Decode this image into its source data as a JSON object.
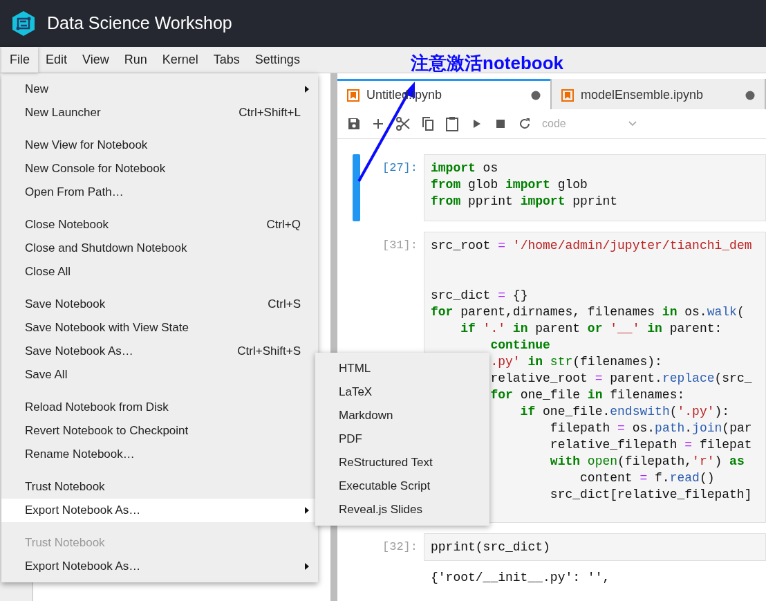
{
  "app": {
    "title": "Data Science Workshop"
  },
  "menu_bar": [
    {
      "label": "File",
      "selected": true
    },
    {
      "label": "Edit",
      "selected": false
    },
    {
      "label": "View",
      "selected": false
    },
    {
      "label": "Run",
      "selected": false
    },
    {
      "label": "Kernel",
      "selected": false
    },
    {
      "label": "Tabs",
      "selected": false
    },
    {
      "label": "Settings",
      "selected": false
    }
  ],
  "file_menu": [
    [
      {
        "label": "New",
        "submenu": true,
        "disabled": false,
        "selected": false
      },
      {
        "label": "New Launcher",
        "shortcut": "Ctrl+Shift+L",
        "submenu": false,
        "disabled": false,
        "selected": false
      }
    ],
    [
      {
        "label": "New View for Notebook",
        "submenu": false,
        "disabled": false,
        "selected": false
      },
      {
        "label": "New Console for Notebook",
        "submenu": false,
        "disabled": false,
        "selected": false
      },
      {
        "label": "Open From Path…",
        "submenu": false,
        "disabled": false,
        "selected": false
      }
    ],
    [
      {
        "label": "Close Notebook",
        "shortcut": "Ctrl+Q",
        "submenu": false,
        "disabled": false,
        "selected": false
      },
      {
        "label": "Close and Shutdown Notebook",
        "submenu": false,
        "disabled": false,
        "selected": false
      },
      {
        "label": "Close All",
        "submenu": false,
        "disabled": false,
        "selected": false
      }
    ],
    [
      {
        "label": "Save Notebook",
        "shortcut": "Ctrl+S",
        "submenu": false,
        "disabled": false,
        "selected": false
      },
      {
        "label": "Save Notebook with View State",
        "submenu": false,
        "disabled": false,
        "selected": false
      },
      {
        "label": "Save Notebook As…",
        "shortcut": "Ctrl+Shift+S",
        "submenu": false,
        "disabled": false,
        "selected": false
      },
      {
        "label": "Save All",
        "submenu": false,
        "disabled": false,
        "selected": false
      }
    ],
    [
      {
        "label": "Reload Notebook from Disk",
        "submenu": false,
        "disabled": false,
        "selected": false
      },
      {
        "label": "Revert Notebook to Checkpoint",
        "submenu": false,
        "disabled": false,
        "selected": false
      },
      {
        "label": "Rename Notebook…",
        "submenu": false,
        "disabled": false,
        "selected": false
      }
    ],
    [
      {
        "label": "Trust Notebook",
        "submenu": false,
        "disabled": false,
        "selected": false
      },
      {
        "label": "Export Notebook As…",
        "submenu": true,
        "disabled": false,
        "selected": true
      }
    ],
    [
      {
        "label": "Trust Notebook",
        "submenu": false,
        "disabled": true,
        "selected": false
      },
      {
        "label": "Export Notebook As…",
        "submenu": true,
        "disabled": false,
        "selected": false
      }
    ]
  ],
  "export_submenu": [
    "HTML",
    "LaTeX",
    "Markdown",
    "PDF",
    "ReStructured Text",
    "Executable Script",
    "Reveal.js Slides"
  ],
  "annotation": {
    "text": "注意激活notebook"
  },
  "tabs": [
    {
      "label": "Untitled.ipynb",
      "selected": true
    },
    {
      "label": "modelEnsemble.ipynb",
      "selected": false
    }
  ],
  "toolbar": {
    "cell_type": "code"
  },
  "cells": [
    {
      "prompt": "[27]:",
      "selected": true,
      "lines": [
        {
          "tokens": [
            {
              "kind": "k",
              "text": "import"
            },
            {
              "kind": "n",
              "text": " os"
            }
          ]
        },
        {
          "tokens": [
            {
              "kind": "k",
              "text": "from"
            },
            {
              "kind": "n",
              "text": " glob"
            },
            {
              "kind": "k",
              "text": " import"
            },
            {
              "kind": "n",
              "text": " glob"
            }
          ]
        },
        {
          "tokens": [
            {
              "kind": "k",
              "text": "from"
            },
            {
              "kind": "n",
              "text": " pprint"
            },
            {
              "kind": "k",
              "text": " import"
            },
            {
              "kind": "n",
              "text": " pprint"
            }
          ]
        }
      ]
    },
    {
      "prompt": "[31]:",
      "selected": false,
      "lines": [
        {
          "tokens": [
            {
              "kind": "n",
              "text": "src_root"
            },
            {
              "kind": "o",
              "text": " ="
            },
            {
              "kind": "s",
              "text": " '/home/admin/jupyter/tianchi_dem"
            }
          ]
        },
        {
          "gap_before": true,
          "tokens": [
            {
              "kind": "n",
              "text": "src_dict"
            },
            {
              "kind": "o",
              "text": " ="
            },
            {
              "kind": "n",
              "text": " {}"
            }
          ]
        },
        {
          "tokens": [
            {
              "kind": "k",
              "text": "for"
            },
            {
              "kind": "n",
              "text": " parent,dirnames, filenames"
            },
            {
              "kind": "k",
              "text": " in"
            },
            {
              "kind": "n",
              "text": " os."
            },
            {
              "kind": "f",
              "text": "walk"
            },
            {
              "kind": "n",
              "text": "("
            }
          ]
        },
        {
          "tokens": [
            {
              "kind": "k",
              "text": "    if"
            },
            {
              "kind": "s",
              "text": " '.'"
            },
            {
              "kind": "k",
              "text": " in"
            },
            {
              "kind": "n",
              "text": " parent"
            },
            {
              "kind": "k",
              "text": " or"
            },
            {
              "kind": "s",
              "text": " '__'"
            },
            {
              "kind": "k",
              "text": " in"
            },
            {
              "kind": "n",
              "text": " parent:"
            }
          ]
        },
        {
          "tokens": [
            {
              "kind": "k",
              "text": "        continue"
            }
          ]
        },
        {
          "tokens": [
            {
              "kind": "s",
              "text": "        .py'"
            },
            {
              "kind": "k",
              "text": " in"
            },
            {
              "kind": "b",
              "text": " str"
            },
            {
              "kind": "n",
              "text": "(filenames):"
            }
          ]
        },
        {
          "tokens": [
            {
              "kind": "n",
              "text": "        relative_root"
            },
            {
              "kind": "o",
              "text": " ="
            },
            {
              "kind": "n",
              "text": " parent."
            },
            {
              "kind": "f",
              "text": "replace"
            },
            {
              "kind": "n",
              "text": "(src_"
            }
          ]
        },
        {
          "tokens": [
            {
              "kind": "k",
              "text": "        for"
            },
            {
              "kind": "n",
              "text": " one_file"
            },
            {
              "kind": "k",
              "text": " in"
            },
            {
              "kind": "n",
              "text": " filenames:"
            }
          ]
        },
        {
          "tokens": [
            {
              "kind": "k",
              "text": "            if"
            },
            {
              "kind": "n",
              "text": " one_file."
            },
            {
              "kind": "f",
              "text": "endswith"
            },
            {
              "kind": "n",
              "text": "("
            },
            {
              "kind": "s",
              "text": "'.py'"
            },
            {
              "kind": "n",
              "text": "):"
            }
          ]
        },
        {
          "tokens": [
            {
              "kind": "n",
              "text": "                filepath"
            },
            {
              "kind": "o",
              "text": " ="
            },
            {
              "kind": "n",
              "text": " os."
            },
            {
              "kind": "f",
              "text": "path"
            },
            {
              "kind": "n",
              "text": "."
            },
            {
              "kind": "f",
              "text": "join"
            },
            {
              "kind": "n",
              "text": "(par"
            }
          ]
        },
        {
          "tokens": [
            {
              "kind": "n",
              "text": "                relative_filepath"
            },
            {
              "kind": "o",
              "text": " ="
            },
            {
              "kind": "n",
              "text": " filepat"
            }
          ]
        },
        {
          "tokens": [
            {
              "kind": "k",
              "text": "                with"
            },
            {
              "kind": "b",
              "text": " open"
            },
            {
              "kind": "n",
              "text": "(filepath,"
            },
            {
              "kind": "s",
              "text": "'r'"
            },
            {
              "kind": "n",
              "text": ")"
            },
            {
              "kind": "k",
              "text": " as"
            }
          ]
        },
        {
          "tokens": [
            {
              "kind": "n",
              "text": "                    content"
            },
            {
              "kind": "o",
              "text": " ="
            },
            {
              "kind": "n",
              "text": " f."
            },
            {
              "kind": "f",
              "text": "read"
            },
            {
              "kind": "n",
              "text": "()"
            }
          ]
        },
        {
          "tokens": [
            {
              "kind": "n",
              "text": "                src_dict[relative_filepath]"
            }
          ]
        }
      ]
    },
    {
      "prompt": "[32]:",
      "selected": false,
      "lines": [
        {
          "tokens": [
            {
              "kind": "n",
              "text": "pprint(src_dict)"
            }
          ]
        }
      ],
      "output": [
        "{'root/__init__.py': '',"
      ]
    }
  ]
}
